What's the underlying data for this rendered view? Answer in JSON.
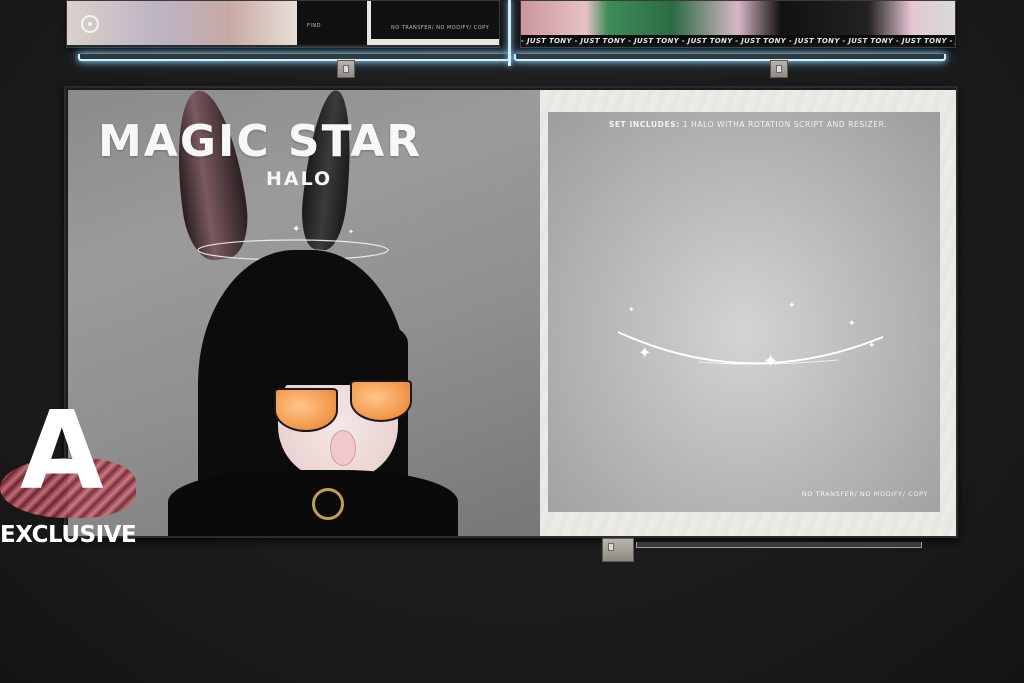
{
  "top_panels": {
    "left": {
      "logo": "circle-logo-icon",
      "small_text_left": "FIND",
      "small_text_mid": "NO TRANSFER/ NO MODIFY/ COPY"
    },
    "right": {
      "strip_text": "- JUST TONY - JUST TONY - JUST TONY - JUST TONY - JUST TONY - JUST TONY - JUST TONY - JUST TONY - JUST TONY -"
    }
  },
  "ad": {
    "title": "MAGIC STAR",
    "subtitle": "HALO",
    "set_includes_label": "SET INCLUDES:",
    "set_includes_text": "1 HALO WITHA ROTATION SCRIPT AND RESIZER.",
    "permissions": "NO TRANSFER/ NO MODIFY/ COPY"
  },
  "badge": {
    "letter": "A",
    "label": "EXCLUSIVE"
  },
  "colors": {
    "neon": "#cfefff",
    "background": "#1c1c1c",
    "lens": "#f19447"
  }
}
